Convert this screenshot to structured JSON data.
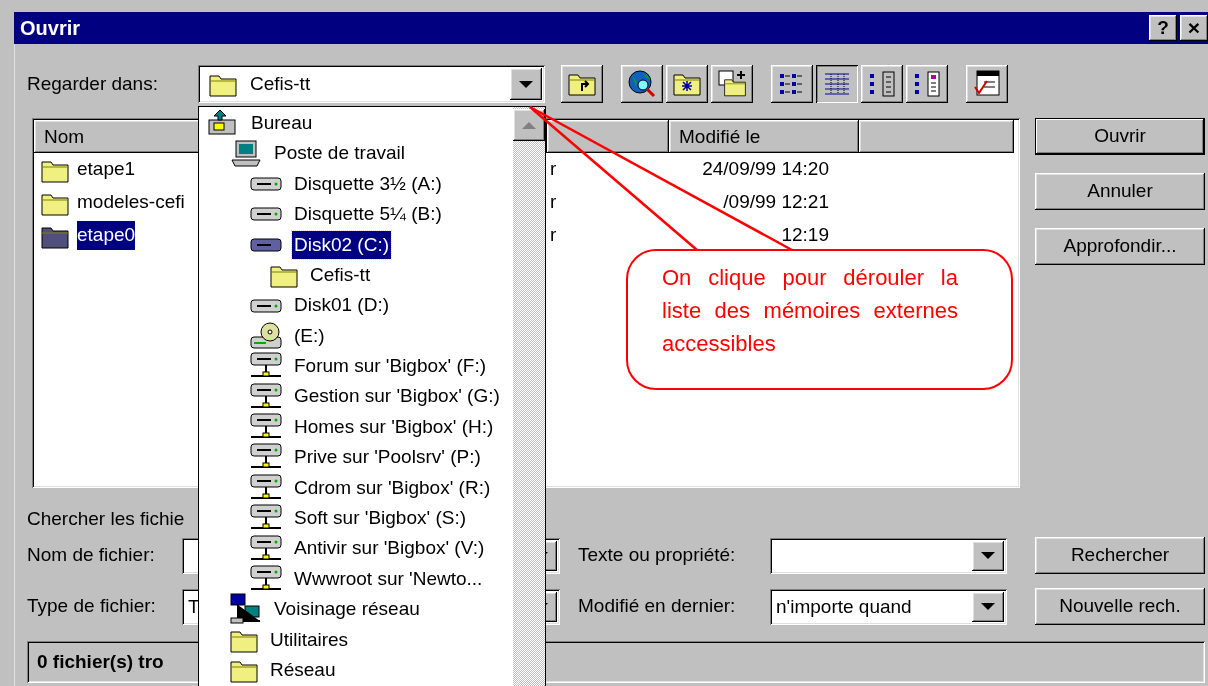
{
  "window": {
    "title": "Ouvrir",
    "buttons": [
      {
        "kind": "help",
        "label": "?"
      },
      {
        "kind": "close",
        "label": "×"
      }
    ]
  },
  "look_in": {
    "label": "Regarder dans:",
    "value": "Cefis-tt"
  },
  "toolbar": [
    {
      "kind": "up-folder",
      "pressed": false
    },
    {
      "kind": "web-search",
      "pressed": false
    },
    {
      "kind": "favorites",
      "pressed": false
    },
    {
      "kind": "add-favorite",
      "pressed": false
    },
    {
      "kind": "list-view",
      "pressed": false
    },
    {
      "kind": "details-view",
      "pressed": true
    },
    {
      "kind": "properties-view",
      "pressed": false
    },
    {
      "kind": "preview-view",
      "pressed": false
    },
    {
      "kind": "commands",
      "pressed": false
    }
  ],
  "file_list": {
    "columns": [
      "Nom",
      "Modifié le"
    ],
    "rows": [
      {
        "name": "etape1",
        "type": "r",
        "modified": "24/09/99 14:20",
        "selected": false
      },
      {
        "name": "modeles-cefi",
        "type": "r",
        "modified": "/09/99 12:21",
        "selected": false
      },
      {
        "name": "etape0",
        "type": "r",
        "modified": "12:19",
        "selected": true
      }
    ]
  },
  "action_buttons": [
    {
      "label": "Ouvrir",
      "default": true
    },
    {
      "label": "Annuler",
      "default": false
    },
    {
      "label": "Approfondir...",
      "default": false
    }
  ],
  "search": {
    "heading": "Chercher les fichie",
    "fields": [
      {
        "label": "Nom de fichier:"
      },
      {
        "label": "Texte ou propriété:"
      },
      {
        "label": "Type de fichier:",
        "value": "T"
      },
      {
        "label": "Modifié en dernier:",
        "value": "n'importe quand"
      }
    ],
    "buttons": [
      "Rechercher",
      "Nouvelle rech."
    ]
  },
  "status_bar": "0 fichier(s) tro",
  "look_in_dropdown": [
    {
      "label": "Bureau",
      "kind": "desktop",
      "selected": false,
      "children": [
        {
          "label": "Poste de travail",
          "kind": "computer",
          "selected": false,
          "children": [
            {
              "label": "Disquette 3½ (A:)",
              "kind": "floppy",
              "selected": false
            },
            {
              "label": "Disquette 5¼ (B:)",
              "kind": "floppy",
              "selected": false
            },
            {
              "label": "Disk02 (C:)",
              "kind": "harddisk",
              "selected": true,
              "children": [
                {
                  "label": "Cefis-tt",
                  "kind": "folder",
                  "selected": false
                }
              ]
            },
            {
              "label": "Disk01 (D:)",
              "kind": "floppy",
              "selected": false
            },
            {
              "label": "(E:)",
              "kind": "cdrom",
              "selected": false
            },
            {
              "label": "Forum sur 'Bigbox' (F:)",
              "kind": "netdrive",
              "selected": false
            },
            {
              "label": "Gestion sur 'Bigbox' (G:)",
              "kind": "netdrive",
              "selected": false
            },
            {
              "label": "Homes sur 'Bigbox' (H:)",
              "kind": "netdrive",
              "selected": false
            },
            {
              "label": "Prive sur 'Poolsrv' (P:)",
              "kind": "netdrive",
              "selected": false
            },
            {
              "label": "Cdrom sur 'Bigbox' (R:)",
              "kind": "netdrive",
              "selected": false
            },
            {
              "label": "Soft sur 'Bigbox' (S:)",
              "kind": "netdrive",
              "selected": false
            },
            {
              "label": "Antivir sur 'Bigbox' (V:)",
              "kind": "netdrive",
              "selected": false
            },
            {
              "label": "Wwwroot sur 'Newto...",
              "kind": "netdrive",
              "selected": false
            }
          ]
        },
        {
          "label": "Voisinage réseau",
          "kind": "network",
          "selected": false
        },
        {
          "label": "Utilitaires",
          "kind": "folder",
          "selected": false
        },
        {
          "label": "Réseau",
          "kind": "folder",
          "selected": false
        }
      ]
    }
  ],
  "callout": "On clique pour dérouler la liste des mémoires externes accessibles"
}
